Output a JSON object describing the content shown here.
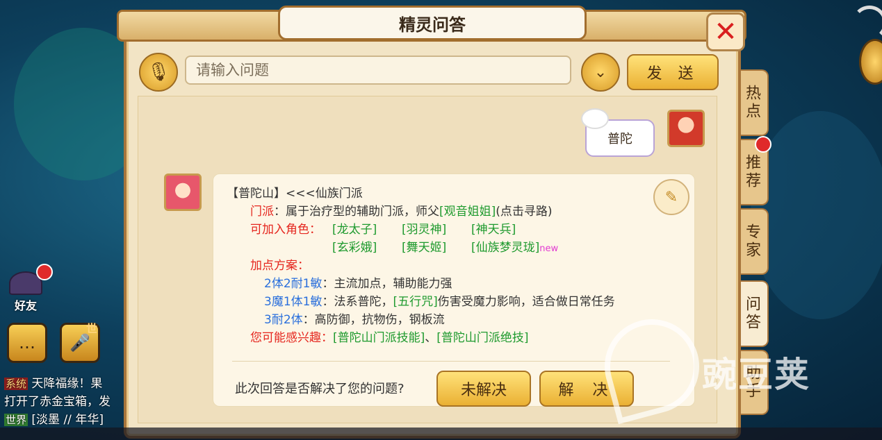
{
  "dialog": {
    "title": "精灵问答",
    "close_glyph": "✕"
  },
  "input": {
    "placeholder": "请输入问题",
    "send_label": "发 送"
  },
  "side_tabs": [
    "热点",
    "推荐",
    "专家",
    "问答",
    "助手"
  ],
  "user_message": "普陀",
  "answer": {
    "heading": "【普陀山】<<<仙族门派",
    "sect_label": "门派",
    "sect_text": "：属于治疗型的辅助门派，师父",
    "master_link": "[观音姐姐]",
    "master_hint": "(点击寻路)",
    "roles_label": "可加入角色：",
    "roles_row1": [
      "[龙太子]",
      "[羽灵神]",
      "[神天兵]"
    ],
    "roles_row2": [
      "[玄彩娥]",
      "[舞天姬]",
      "[仙族梦灵珑]"
    ],
    "new_tag": "new",
    "plan_label": "加点方案：",
    "plans": [
      {
        "name": "2体2耐1敏",
        "desc": "：主流加点，辅助能力强"
      },
      {
        "name": "3魔1体1敏",
        "desc_pre": "：法系普陀，",
        "link": "[五行咒]",
        "desc_post": "伤害受魔力影响，适合做日常任务"
      },
      {
        "name": "3耐2体",
        "desc": "：高防御，抗物伤，钢板流"
      }
    ],
    "interest_label": "您可能感兴趣：",
    "interest_link1": "[普陀山门派技能]",
    "interest_sep": "、",
    "interest_link2": "[普陀山门派绝技]"
  },
  "feedback": {
    "question": "此次回答是否解决了您的问题?",
    "unsolved_label": "未解决",
    "solved_label": "解 决"
  },
  "left_hud": {
    "friends_label": "好友",
    "voice_badge": "世",
    "chat_lines": [
      {
        "tag": "系统",
        "text": " 天降福缘！果"
      },
      {
        "tag": "",
        "text": "打开了赤金宝箱，发"
      },
      {
        "tag": "世界",
        "text": " [淡墨 // 年华]"
      }
    ]
  },
  "watermark": "豌豆荚"
}
